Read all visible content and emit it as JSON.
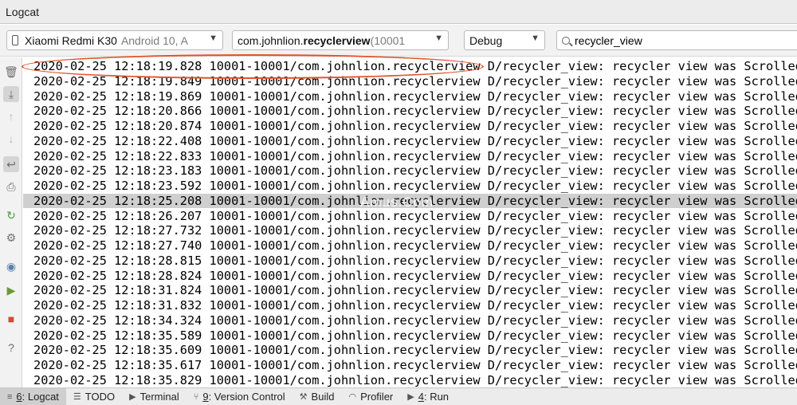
{
  "panel": {
    "title": "Logcat"
  },
  "filters": {
    "device": {
      "name": "Xiaomi Redmi K30",
      "detail": "Android 10, A"
    },
    "process": {
      "prefix": "com.johnlion.",
      "bold": "recyclerview",
      "suffix": " (10001"
    },
    "level": "Debug",
    "search": {
      "value": "recycler_view"
    }
  },
  "toolbar_icons": [
    "trash-icon",
    "scroll-to-end-icon",
    "up-arrow-icon",
    "down-arrow-icon",
    "soft-wrap-icon",
    "print-icon",
    "restart-icon",
    "settings-icon",
    "screenshot-icon",
    "screen-record-icon",
    "stop-icon",
    "help-icon"
  ],
  "log": {
    "process": "10001-10001/com.johnlion.recyclerview",
    "tag": "D/recycler_view:",
    "message": "recycler view was Scrolled...",
    "timestamps": [
      "2020-02-25 12:18:19.828",
      "2020-02-25 12:18:19.849",
      "2020-02-25 12:18:19.869",
      "2020-02-25 12:18:20.866",
      "2020-02-25 12:18:20.874",
      "2020-02-25 12:18:22.408",
      "2020-02-25 12:18:22.833",
      "2020-02-25 12:18:23.183",
      "2020-02-25 12:18:23.592",
      "2020-02-25 12:18:25.208",
      "2020-02-25 12:18:26.207",
      "2020-02-25 12:18:27.732",
      "2020-02-25 12:18:27.740",
      "2020-02-25 12:18:28.815",
      "2020-02-25 12:18:28.824",
      "2020-02-25 12:18:31.824",
      "2020-02-25 12:18:31.832",
      "2020-02-25 12:18:34.324",
      "2020-02-25 12:18:35.589",
      "2020-02-25 12:18:35.609",
      "2020-02-25 12:18:35.617",
      "2020-02-25 12:18:35.829"
    ],
    "highlighted_index": 9
  },
  "watermark": "Amus.Com",
  "bottom_tabs": [
    {
      "mnemonic": "6",
      "label": ": Logcat",
      "icon": "logcat-icon"
    },
    {
      "mnemonic": "",
      "label": "TODO",
      "icon": "todo-icon"
    },
    {
      "mnemonic": "",
      "label": "Terminal",
      "icon": "terminal-icon"
    },
    {
      "mnemonic": "9",
      "label": ": Version Control",
      "icon": "version-control-icon"
    },
    {
      "mnemonic": "",
      "label": "Build",
      "icon": "build-icon"
    },
    {
      "mnemonic": "",
      "label": "Profiler",
      "icon": "profiler-icon"
    },
    {
      "mnemonic": "4",
      "label": ": Run",
      "icon": "run-icon"
    }
  ],
  "colors": {
    "callout": "#e2542b",
    "highlight_row": "#cfcfcf",
    "active_tab": "#cfcfcf"
  }
}
